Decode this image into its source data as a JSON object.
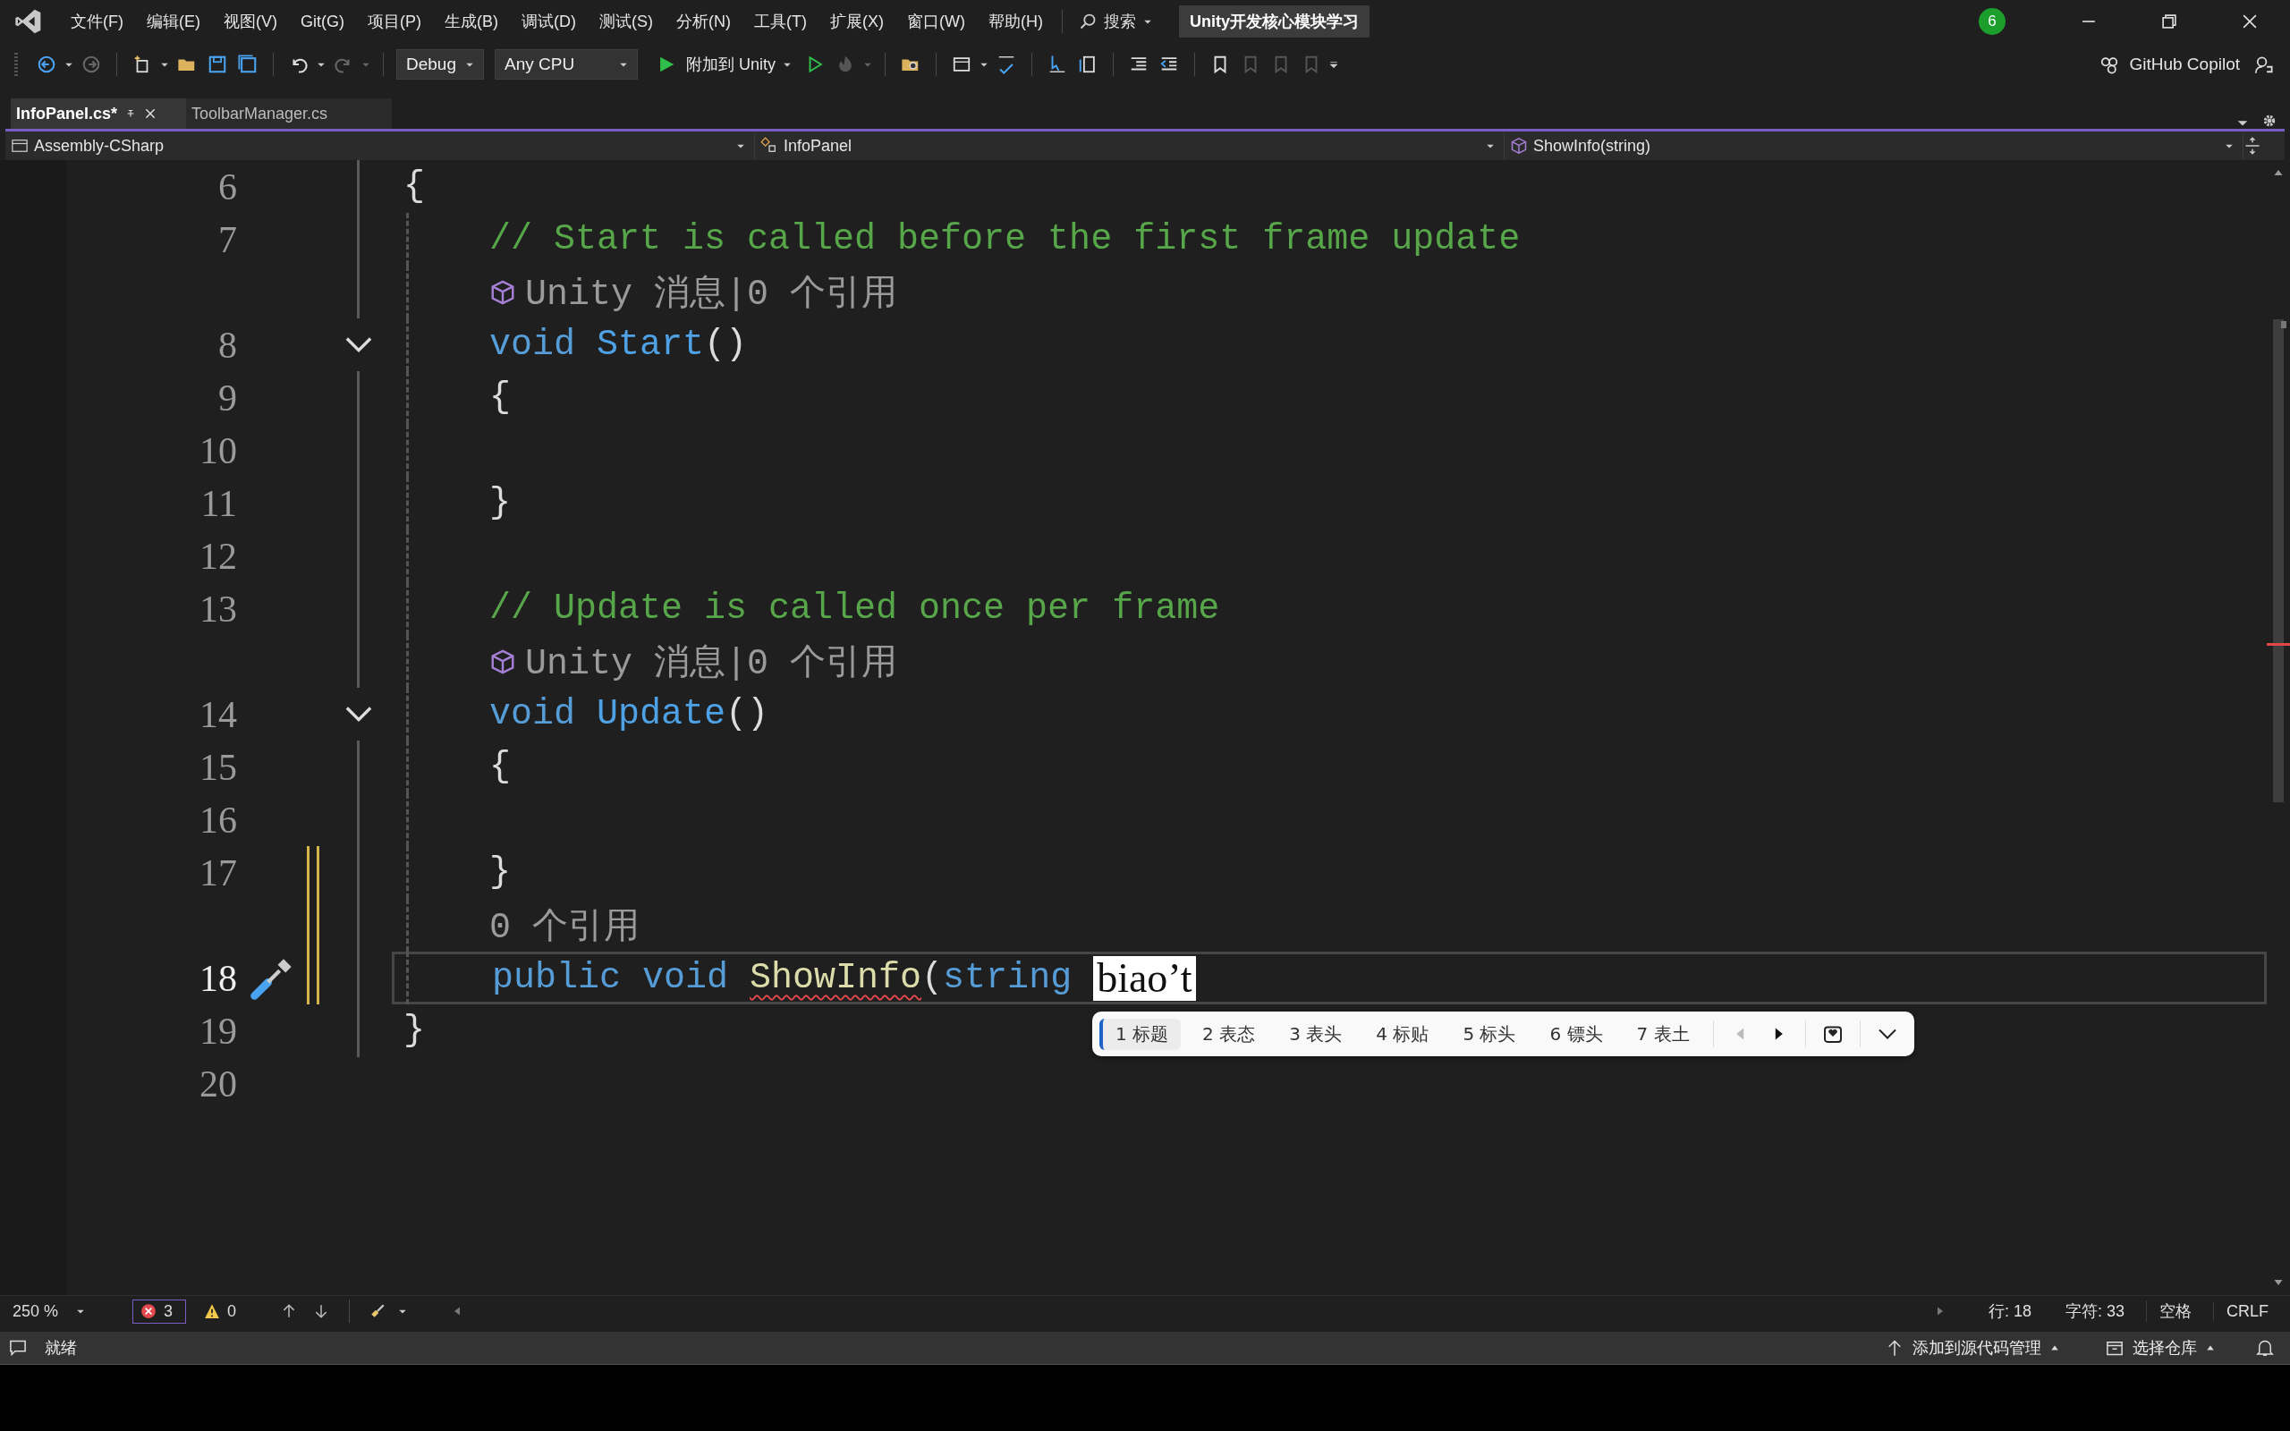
{
  "menu": {
    "items": [
      "文件(F)",
      "编辑(E)",
      "视图(V)",
      "Git(G)",
      "项目(P)",
      "生成(B)",
      "调试(D)",
      "测试(S)",
      "分析(N)",
      "工具(T)",
      "扩展(X)",
      "窗口(W)",
      "帮助(H)"
    ],
    "search": "搜索",
    "solution": "Unity开发核心模块学习",
    "notifications": "6"
  },
  "toolbar": {
    "configuration": "Debug",
    "platform": "Any CPU",
    "run": "附加到 Unity",
    "copilot": "GitHub Copilot"
  },
  "tabs": [
    {
      "label": "InfoPanel.cs*",
      "selected": true
    },
    {
      "label": "ToolbarManager.cs",
      "selected": false
    }
  ],
  "nav": {
    "project": "Assembly-CSharp",
    "type": "InfoPanel",
    "member": "ShowInfo(string)"
  },
  "rows": [
    {
      "kind": "code",
      "number": "6",
      "fold": false,
      "modified": false,
      "current": false,
      "quick_action": false,
      "tokens": [
        {
          "kind": "plain",
          "text": "{"
        }
      ]
    },
    {
      "kind": "code",
      "number": "7",
      "fold": false,
      "modified": false,
      "current": false,
      "quick_action": false,
      "tokens": [
        {
          "kind": "comment",
          "text": "    // Start is called before the first frame update"
        }
      ]
    },
    {
      "kind": "lens",
      "text": "Unity 消息|0 个引用",
      "unity": true,
      "modified": false
    },
    {
      "kind": "code",
      "number": "8",
      "fold": true,
      "modified": false,
      "current": false,
      "quick_action": false,
      "tokens": [
        {
          "kind": "keyword",
          "text": "    void "
        },
        {
          "kind": "method",
          "text": "Start"
        },
        {
          "kind": "plain",
          "text": "()"
        }
      ]
    },
    {
      "kind": "code",
      "number": "9",
      "fold": false,
      "modified": false,
      "current": false,
      "quick_action": false,
      "tokens": [
        {
          "kind": "plain",
          "text": "    {"
        }
      ]
    },
    {
      "kind": "code",
      "number": "10",
      "fold": false,
      "modified": false,
      "current": false,
      "quick_action": false
    },
    {
      "kind": "code",
      "number": "11",
      "fold": false,
      "modified": false,
      "current": false,
      "quick_action": false,
      "tokens": [
        {
          "kind": "plain",
          "text": "    }"
        }
      ]
    },
    {
      "kind": "code",
      "number": "12",
      "fold": false,
      "modified": false,
      "current": false,
      "quick_action": false
    },
    {
      "kind": "code",
      "number": "13",
      "fold": false,
      "modified": false,
      "current": false,
      "quick_action": false,
      "tokens": [
        {
          "kind": "comment",
          "text": "    // Update is called once per frame"
        }
      ]
    },
    {
      "kind": "lens",
      "text": "Unity 消息|0 个引用",
      "unity": true,
      "modified": false
    },
    {
      "kind": "code",
      "number": "14",
      "fold": true,
      "modified": false,
      "current": false,
      "quick_action": false,
      "tokens": [
        {
          "kind": "keyword",
          "text": "    void "
        },
        {
          "kind": "method",
          "text": "Update"
        },
        {
          "kind": "plain",
          "text": "()"
        }
      ]
    },
    {
      "kind": "code",
      "number": "15",
      "fold": false,
      "modified": false,
      "current": false,
      "quick_action": false,
      "tokens": [
        {
          "kind": "plain",
          "text": "    {"
        }
      ]
    },
    {
      "kind": "code",
      "number": "16",
      "fold": false,
      "modified": false,
      "current": false,
      "quick_action": false
    },
    {
      "kind": "code",
      "number": "17",
      "fold": false,
      "modified": true,
      "current": false,
      "quick_action": false,
      "tokens": [
        {
          "kind": "plain",
          "text": "    }"
        }
      ]
    },
    {
      "kind": "lens",
      "text": "0 个引用",
      "unity": false,
      "modified": true
    },
    {
      "kind": "code",
      "number": "18",
      "fold": false,
      "modified": true,
      "current": true,
      "quick_action": true,
      "tokens": [
        {
          "kind": "keyword",
          "text": "    public void "
        },
        {
          "kind": "error",
          "text": "ShowInfo"
        },
        {
          "kind": "plain",
          "text": "("
        },
        {
          "kind": "keyword",
          "text": "string "
        },
        {
          "kind": "composition",
          "text": "biao’t"
        }
      ]
    },
    {
      "kind": "code",
      "number": "19",
      "fold": false,
      "modified": false,
      "current": false,
      "quick_action": false,
      "tokens": [
        {
          "kind": "plain",
          "text": "}"
        }
      ]
    },
    {
      "kind": "code",
      "number": "20",
      "fold": false,
      "modified": false,
      "current": false,
      "quick_action": false
    }
  ],
  "ime": {
    "candidates": [
      {
        "label": "1 标题",
        "selected": true
      },
      {
        "label": "2 表态",
        "selected": false
      },
      {
        "label": "3 表头",
        "selected": false
      },
      {
        "label": "4 标贴",
        "selected": false
      },
      {
        "label": "5 标头",
        "selected": false
      },
      {
        "label": "6 镖头",
        "selected": false
      },
      {
        "label": "7 表土",
        "selected": false
      }
    ]
  },
  "editor_status": {
    "zoom": "250 %",
    "errors": "3",
    "warnings": "0",
    "line": "行: 18",
    "column": "字符: 33",
    "indent": "空格",
    "line_ending": "CRLF"
  },
  "status_bar": {
    "message": "就绪",
    "source_control": "添加到源代码管理",
    "repository": "选择仓库"
  }
}
